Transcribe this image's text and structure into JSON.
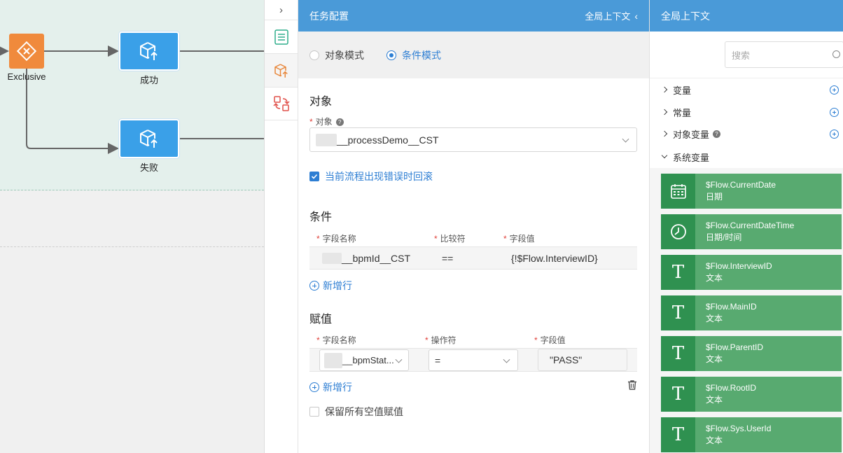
{
  "canvas": {
    "gateway_label": "Exclusive",
    "task_success_label": "成功",
    "task_fail_label": "失败"
  },
  "config": {
    "title": "任务配置",
    "global_context_toggle": "全局上下文",
    "modes": [
      {
        "label": "对象模式",
        "selected": false
      },
      {
        "label": "条件模式",
        "selected": true
      }
    ],
    "object_section": {
      "title": "对象",
      "field_label": "对象",
      "value": "__processDemo__CST"
    },
    "rollback_checkbox": {
      "label": "当前流程出现错误时回滚",
      "checked": true
    },
    "condition_section": {
      "title": "条件",
      "headers": [
        "字段名称",
        "比较符",
        "字段值"
      ],
      "rows": [
        {
          "field": "__bpmId__CST",
          "op": "==",
          "value": "{!$Flow.InterviewID}"
        }
      ],
      "add_row_label": "新增行"
    },
    "assign_section": {
      "title": "赋值",
      "headers": [
        "字段名称",
        "操作符",
        "字段值"
      ],
      "rows": [
        {
          "field": "__bpmStat...",
          "op": "=",
          "value": "\"PASS\""
        }
      ],
      "add_row_label": "新增行"
    },
    "keep_empty_checkbox": {
      "label": "保留所有空值赋值",
      "checked": false
    }
  },
  "context": {
    "title": "全局上下文",
    "search_placeholder": "搜索",
    "tree": [
      {
        "label": "变量",
        "expanded": false,
        "addable": true
      },
      {
        "label": "常量",
        "expanded": false,
        "addable": true
      },
      {
        "label": "对象变量",
        "expanded": false,
        "addable": true,
        "help": true
      },
      {
        "label": "系统变量",
        "expanded": true,
        "addable": false
      }
    ],
    "system_variables": [
      {
        "name": "$Flow.CurrentDate",
        "type": "日期",
        "icon": "calendar-icon"
      },
      {
        "name": "$Flow.CurrentDateTime",
        "type": "日期/时间",
        "icon": "clock-icon"
      },
      {
        "name": "$Flow.InterviewID",
        "type": "文本",
        "icon": "text-icon"
      },
      {
        "name": "$Flow.MainID",
        "type": "文本",
        "icon": "text-icon"
      },
      {
        "name": "$Flow.ParentID",
        "type": "文本",
        "icon": "text-icon"
      },
      {
        "name": "$Flow.RootID",
        "type": "文本",
        "icon": "text-icon"
      },
      {
        "name": "$Flow.Sys.UserId",
        "type": "文本",
        "icon": "text-icon"
      }
    ],
    "text_icon_glyph": "T"
  },
  "colors": {
    "header_blue": "#4a9ad8",
    "accent_blue": "#2d7ed3",
    "gateway_orange": "#f08a3c",
    "task_blue": "#3aa0e8",
    "var_green": "#58aa70",
    "var_icon_green": "#2f9150"
  }
}
